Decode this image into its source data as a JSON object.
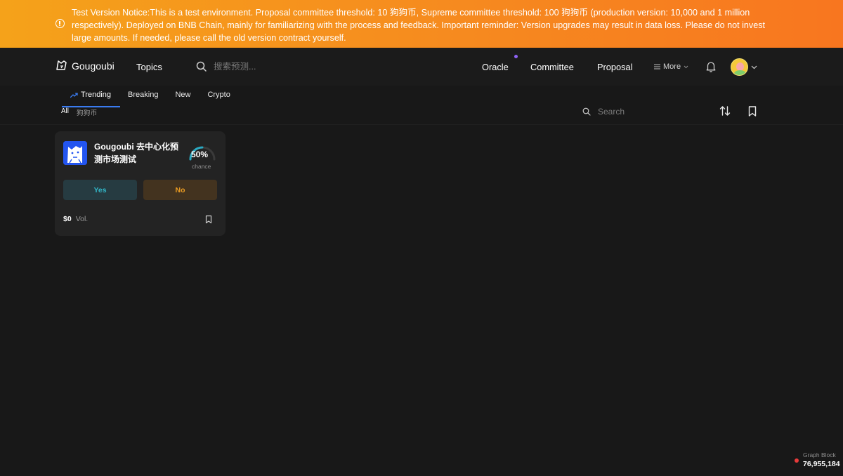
{
  "banner": {
    "text": "Test Version Notice:This is a test environment. Proposal committee threshold: 10 狗狗币, Supreme committee threshold: 100 狗狗币 (production version: 10,000 and 1 million respectively). Deployed on BNB Chain, mainly for familiarizing with the process and feedback. Important reminder: Version upgrades may result in data loss. Please do not invest large amounts. If needed, please call the old version contract yourself.",
    "icon": "info-circle-icon",
    "colors": {
      "start": "#f5a21a",
      "end": "#f8761f"
    }
  },
  "header": {
    "brand": "Gougoubi",
    "topics": "Topics",
    "search_placeholder": "搜索预测...",
    "nav": {
      "oracle": "Oracle",
      "committee": "Committee",
      "proposal": "Proposal",
      "more": "More"
    },
    "oracle_dot_color": "#8f63f6"
  },
  "tabs": {
    "items": [
      {
        "label": "Trending",
        "icon": "trending-icon",
        "active": true
      },
      {
        "label": "Breaking"
      },
      {
        "label": "New"
      },
      {
        "label": "Crypto"
      }
    ],
    "accent": "#3a7bf0"
  },
  "subtabs": {
    "all": "All",
    "coin": "狗狗币"
  },
  "filter": {
    "search_placeholder": "Search"
  },
  "market": {
    "title": "Gougoubi 去中心化预测市场测试",
    "chance_pct": "50%",
    "chance_label": "chance",
    "chance_value": 0.5,
    "yes": "Yes",
    "no": "No",
    "volume": "$0",
    "volume_label": "Vol.",
    "colors": {
      "yes": "#32b6c7",
      "no": "#e89a22"
    }
  },
  "status": {
    "label": "Graph Block",
    "block": "76,955,184",
    "dot_color": "#e83b3b"
  }
}
